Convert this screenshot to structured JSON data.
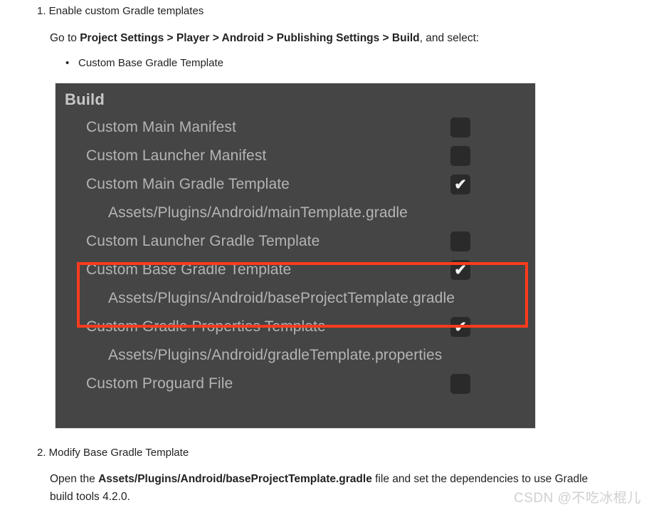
{
  "document": {
    "step1": "1. Enable custom Gradle templates",
    "goto": {
      "prefix": "Go to ",
      "path": "Project Settings > Player > Android > Publishing Settings > Build",
      "suffix": ", and select:"
    },
    "bullet": {
      "marker": "•",
      "text": "Custom Base Gradle Template"
    },
    "step2": "2. Modify Base Gradle Template",
    "para2": {
      "prefix": "Open the ",
      "file": "Assets/Plugins/Android/baseProjectTemplate.gradle",
      "suffix": " file and set the dependencies to use Gradle build tools 4.2.0."
    }
  },
  "panel": {
    "title": "Build",
    "colors": {
      "background": "#454545",
      "text": "#b4b4b4",
      "title_text": "#c8c8c8",
      "checkbox_fill": "#2a2a2a",
      "checkbox_tick": "#f2f2f2",
      "highlight": "#fb3b1e"
    },
    "rows": [
      {
        "type": "label",
        "label": "Custom Main Manifest",
        "checkbox": true,
        "checked": false
      },
      {
        "type": "label",
        "label": "Custom Launcher Manifest",
        "checkbox": true,
        "checked": false
      },
      {
        "type": "label",
        "label": "Custom Main Gradle Template",
        "checkbox": true,
        "checked": true
      },
      {
        "type": "path",
        "label": "Assets/Plugins/Android/mainTemplate.gradle",
        "checkbox": false,
        "checked": false
      },
      {
        "type": "label",
        "label": "Custom Launcher Gradle Template",
        "checkbox": true,
        "checked": false
      },
      {
        "type": "label",
        "label": "Custom Base Gradle Template",
        "checkbox": true,
        "checked": true
      },
      {
        "type": "path",
        "label": "Assets/Plugins/Android/baseProjectTemplate.gradle",
        "checkbox": false,
        "checked": false
      },
      {
        "type": "label",
        "label": "Custom Gradle Properties Template",
        "checkbox": true,
        "checked": true
      },
      {
        "type": "path",
        "label": "Assets/Plugins/Android/gradleTemplate.properties",
        "checkbox": false,
        "checked": false
      },
      {
        "type": "label",
        "label": "Custom Proguard File",
        "checkbox": true,
        "checked": false
      }
    ],
    "tick_glyph": "✔"
  },
  "watermark": "CSDN @不吃冰棍儿"
}
